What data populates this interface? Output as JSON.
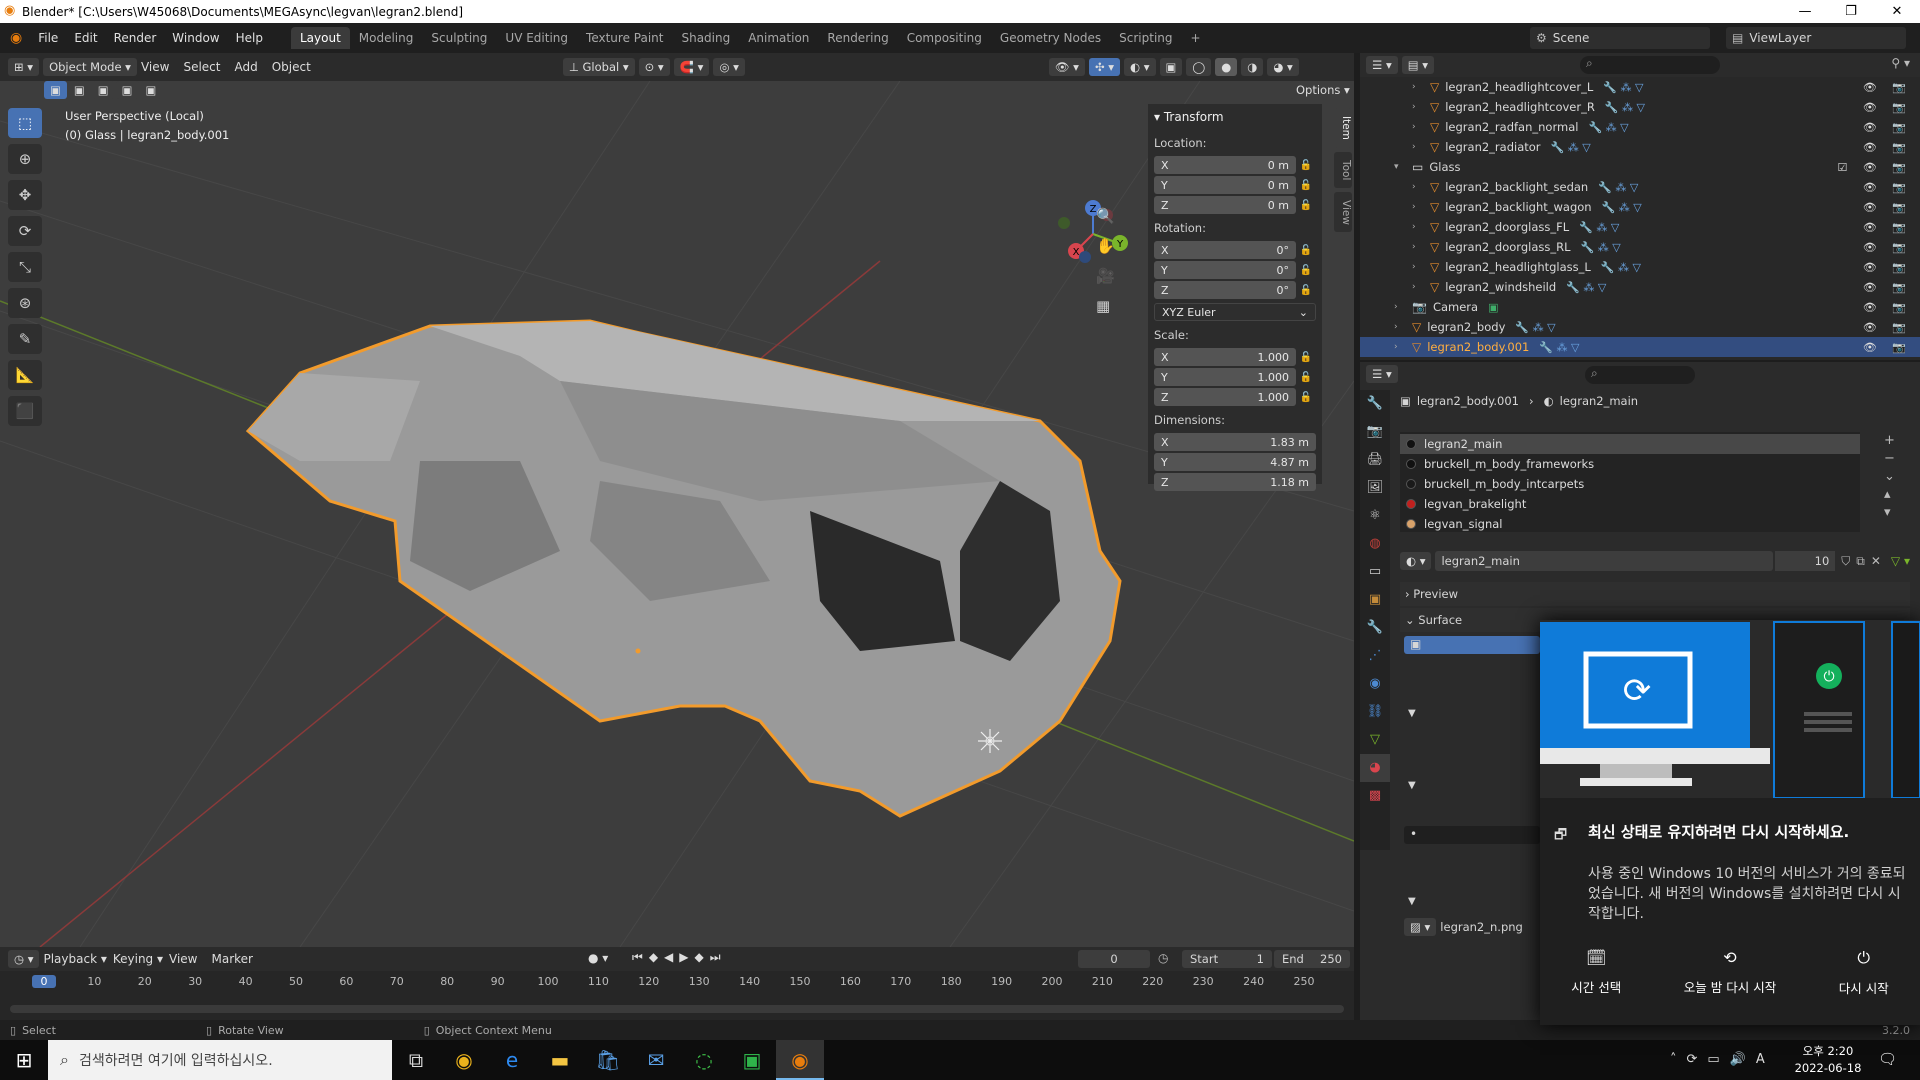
{
  "window": {
    "title": "Blender* [C:\\Users\\W45068\\Documents\\MEGAsync\\legvan\\legran2.blend]",
    "controls": [
      "—",
      "❐",
      "✕"
    ]
  },
  "menu": {
    "items": [
      "File",
      "Edit",
      "Render",
      "Window",
      "Help"
    ],
    "workspaces": [
      "Layout",
      "Modeling",
      "Sculpting",
      "UV Editing",
      "Texture Paint",
      "Shading",
      "Animation",
      "Rendering",
      "Compositing",
      "Geometry Nodes",
      "Scripting"
    ],
    "add_tab": "+",
    "scene_label": "Scene",
    "viewlayer_label": "ViewLayer"
  },
  "viewport_header": {
    "mode": "Object Mode",
    "menus": [
      "View",
      "Select",
      "Add",
      "Object"
    ],
    "orientation": "Global",
    "options": "Options"
  },
  "viewport": {
    "perspective": "User Perspective (Local)",
    "object_info": "(0) Glass | legran2_body.001",
    "gizmo_axes": [
      "Z",
      "Y",
      "X"
    ],
    "colors": {
      "selection_outline": "#f29b2c",
      "x_axis": "#b33a3a",
      "y_axis": "#6a8f2b",
      "bg": "#3d3d3d"
    }
  },
  "side_tabs": [
    "Item",
    "Tool",
    "View"
  ],
  "transform": {
    "title": "Transform",
    "location_label": "Location:",
    "location": [
      {
        "axis": "X",
        "value": "0 m"
      },
      {
        "axis": "Y",
        "value": "0 m"
      },
      {
        "axis": "Z",
        "value": "0 m"
      }
    ],
    "rotation_label": "Rotation:",
    "rotation": [
      {
        "axis": "X",
        "value": "0°"
      },
      {
        "axis": "Y",
        "value": "0°"
      },
      {
        "axis": "Z",
        "value": "0°"
      }
    ],
    "rotation_mode": "XYZ Euler",
    "scale_label": "Scale:",
    "scale": [
      {
        "axis": "X",
        "value": "1.000"
      },
      {
        "axis": "Y",
        "value": "1.000"
      },
      {
        "axis": "Z",
        "value": "1.000"
      }
    ],
    "dimensions_label": "Dimensions:",
    "dimensions": [
      {
        "axis": "X",
        "value": "1.83 m"
      },
      {
        "axis": "Y",
        "value": "4.87 m"
      },
      {
        "axis": "Z",
        "value": "1.18 m"
      }
    ]
  },
  "outliner": {
    "rows": [
      {
        "name": "legran2_headlightcover_L",
        "type": "mesh",
        "depth": 2
      },
      {
        "name": "legran2_headlightcover_R",
        "type": "mesh",
        "depth": 2
      },
      {
        "name": "legran2_radfan_normal",
        "type": "mesh",
        "depth": 2
      },
      {
        "name": "legran2_radiator",
        "type": "mesh",
        "depth": 2
      },
      {
        "name": "Glass",
        "type": "collection",
        "depth": 1
      },
      {
        "name": "legran2_backlight_sedan",
        "type": "mesh",
        "depth": 2
      },
      {
        "name": "legran2_backlight_wagon",
        "type": "mesh",
        "depth": 2
      },
      {
        "name": "legran2_doorglass_FL",
        "type": "mesh",
        "depth": 2
      },
      {
        "name": "legran2_doorglass_RL",
        "type": "mesh",
        "depth": 2
      },
      {
        "name": "legran2_headlightglass_L",
        "type": "mesh",
        "depth": 2
      },
      {
        "name": "legran2_windsheild",
        "type": "mesh",
        "depth": 2
      },
      {
        "name": "Camera",
        "type": "camera",
        "depth": 1
      },
      {
        "name": "legran2_body",
        "type": "mesh",
        "depth": 1
      },
      {
        "name": "legran2_body.001",
        "type": "mesh",
        "depth": 1,
        "selected": true
      }
    ]
  },
  "properties": {
    "breadcrumb_object": "legran2_body.001",
    "breadcrumb_material": "legran2_main",
    "material_slots": [
      {
        "name": "legran2_main",
        "color": "#111111",
        "selected": true
      },
      {
        "name": "bruckell_m_body_frameworks",
        "color": "#111111"
      },
      {
        "name": "bruckell_m_body_intcarpets",
        "color": "#1a1a1a"
      },
      {
        "name": "legvan_brakelight",
        "color": "#c0201e"
      },
      {
        "name": "legvan_signal",
        "color": "#d8a26a"
      }
    ],
    "material_name": "legran2_main",
    "material_users": "10",
    "preview_label": "Preview",
    "surface_label": "Surface",
    "texture_name": "legran2_n.png"
  },
  "timeline": {
    "menus": [
      "Playback",
      "Keying",
      "View",
      "Marker"
    ],
    "current_frame": "0",
    "start_label": "Start",
    "start": "1",
    "end_label": "End",
    "end": "250",
    "ticks": [
      "0",
      "10",
      "20",
      "30",
      "40",
      "50",
      "60",
      "70",
      "80",
      "90",
      "100",
      "110",
      "120",
      "130",
      "140",
      "150",
      "160",
      "170",
      "180",
      "190",
      "200",
      "210",
      "220",
      "230",
      "240",
      "250"
    ]
  },
  "statusbar": {
    "select": "Select",
    "rotate": "Rotate View",
    "context": "Object Context Menu",
    "version": "3.2.0"
  },
  "notification": {
    "title": "최신 상태로 유지하려면 다시 시작하세요.",
    "body": "사용 중인 Windows 10 버전의 서비스가 거의 종료되었습니다. 새 버전의 Windows를 설치하려면 다시 시작합니다.",
    "actions": [
      "시간 선택",
      "오늘 밤 다시 시작",
      "다시 시작"
    ]
  },
  "taskbar": {
    "search_placeholder": "검색하려면 여기에 입력하십시오.",
    "time": "오후 2:20",
    "date": "2022-06-18",
    "ime": "A"
  }
}
